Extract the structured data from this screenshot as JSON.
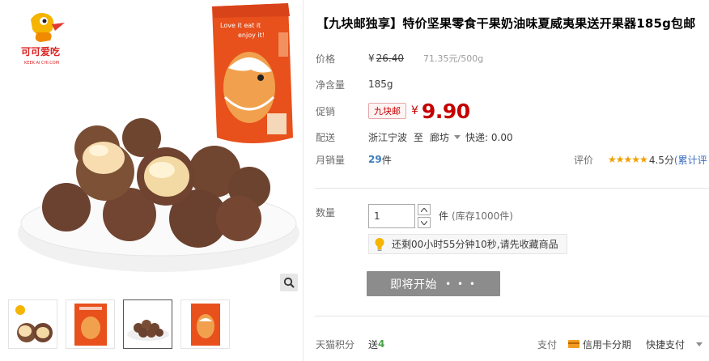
{
  "gallery": {
    "brand_logo_text": "KEEK AI CHI.COM",
    "bag_text": "Love it eat it enjoy it!",
    "thumbnails": [
      "thumb-1",
      "thumb-2",
      "thumb-3",
      "thumb-4"
    ],
    "active_thumbnail": 3
  },
  "product": {
    "title": "【九块邮独享】特价坚果零食干果奶油味夏威夷果送开果器185g包邮",
    "price_label": "价格",
    "original_price_yen": "¥",
    "original_price": "26.40",
    "unit_price": "71.35元/500g",
    "net_label": "净含量",
    "net_value": "185g",
    "promo_label": "促销",
    "promo_tag": "九块邮",
    "promo_yen": "¥",
    "promo_price": "9.90",
    "shipping_label": "配送",
    "ship_from": "浙江宁波",
    "ship_to_word": "至",
    "ship_to": "廊坊",
    "shipping_fee": "快递: 0.00",
    "monthly_sales_label": "月销量",
    "monthly_sales_num": "29",
    "monthly_sales_unit": "件",
    "rating_label": "评价",
    "rating_stars": "★★★★★",
    "rating_score": "4.5分",
    "review_link": "(累计评"
  },
  "purchase": {
    "qty_label": "数量",
    "qty_value": "1",
    "qty_unit": "件",
    "stock": "(库存1000件)",
    "reminder": "还剩00小时55分钟10秒,请先收藏商品",
    "start_button": "即将开始",
    "start_button_dots": "• • •"
  },
  "footer": {
    "points_label": "天猫积分",
    "points_prefix": "送",
    "points_num": "4",
    "pay_label": "支付",
    "pay_card": "信用卡分期",
    "pay_quick": "快捷支付"
  },
  "colors": {
    "accent_red": "#c40000",
    "sales_blue": "#3c7cbf",
    "points_green": "#4ca24c",
    "button_gray": "#8c8c8c",
    "star_orange": "#f0a000"
  }
}
